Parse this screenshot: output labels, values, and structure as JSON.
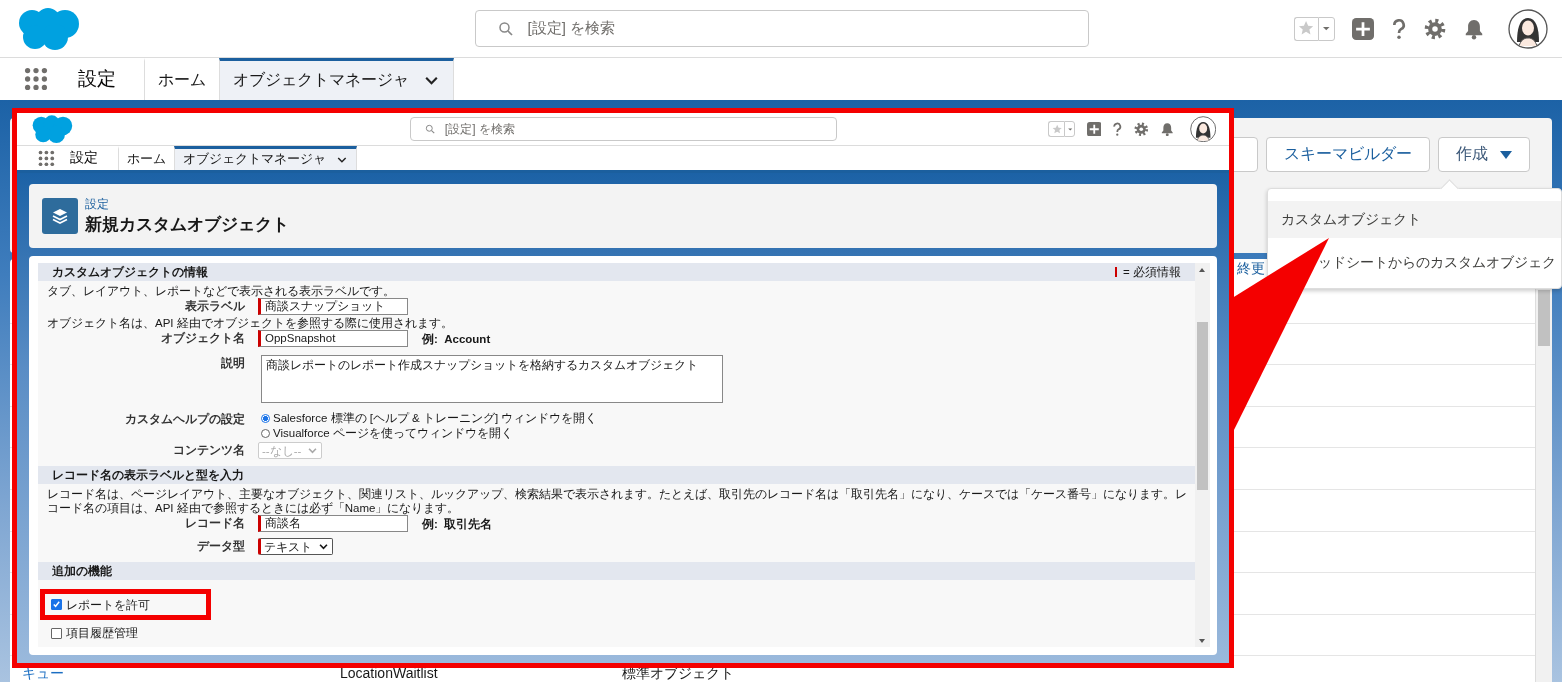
{
  "header": {
    "search": {
      "placeholder": "[設定] を検索"
    }
  },
  "nav": {
    "app_name": "設定",
    "tabs": [
      {
        "label": "ホーム",
        "selected": false
      },
      {
        "label": "オブジェクトマネージャ",
        "selected": true
      }
    ]
  },
  "toolbar": {
    "buttons": [
      {
        "label": "スキーマビルダー",
        "kind": "plain"
      },
      {
        "label": "作成",
        "kind": "menu"
      }
    ]
  },
  "create_menu": {
    "items": [
      {
        "label": "カスタムオブジェクト",
        "selected": true
      },
      {
        "label": "ッドシートからのカスタムオブジェク",
        "selected": false
      }
    ]
  },
  "table": {
    "column_4_header": "終更",
    "rows": [
      {
        "cells": [
          {
            "text": "キュー",
            "kind": "link"
          },
          {
            "text": "LocationWaitlist",
            "kind": "plain"
          },
          {
            "text": "標準オブジェクト",
            "kind": "plain"
          }
        ]
      }
    ]
  },
  "screenshot": {
    "header": {
      "search": {
        "placeholder": "[設定] を検索"
      }
    },
    "nav": {
      "app_name": "設定",
      "tabs": [
        {
          "label": "ホーム",
          "selected": false
        },
        {
          "label": "オブジェクトマネージャ",
          "selected": true
        }
      ]
    },
    "page": {
      "breadcrumb": "設定",
      "title": "新規カスタムオブジェクト"
    },
    "form": {
      "required_legend": "= 必須情報",
      "sections": [
        {
          "title": "カスタムオブジェクトの情報",
          "fields": [
            {
              "kind": "hint",
              "text": "タブ、レイアウト、レポートなどで表示される表示ラベルです。"
            },
            {
              "kind": "text",
              "label": "表示ラベル",
              "value": "商談スナップショット",
              "required": true
            },
            {
              "kind": "hint",
              "text": "オブジェクト名は、API 経由でオブジェクトを参照する際に使用されます。"
            },
            {
              "kind": "text",
              "label": "オブジェクト名",
              "value": "OppSnapshot",
              "required": true,
              "example": "例:  Account"
            },
            {
              "kind": "textarea",
              "label": "説明",
              "value": "商談レポートのレポート作成スナップショットを格納するカスタムオブジェクト"
            },
            {
              "kind": "radio",
              "label": "カスタムヘルプの設定",
              "options": [
                {
                  "label": "Salesforce 標準の [ヘルプ & トレーニング] ウィンドウを開く",
                  "selected": true
                },
                {
                  "label": "Visualforce ページを使ってウィンドウを開く",
                  "selected": false
                }
              ]
            },
            {
              "kind": "select",
              "label": "コンテンツ名",
              "value": "--なし--",
              "disabled": true,
              "required": false
            }
          ]
        },
        {
          "title": "レコード名の表示ラベルと型を入力",
          "fields": [
            {
              "kind": "hint",
              "text": "レコード名は、ページレイアウト、主要なオブジェクト、関連リスト、ルックアップ、検索結果で表示されます。たとえば、取引先のレコード名は「取引先名」になり、ケースでは「ケース番号」になります。レコード名の項目は、API 経由で参照するときには必ず「Name」になります。"
            },
            {
              "kind": "text",
              "label": "レコード名",
              "value": "商談名",
              "required": true,
              "example": "例:  取引先名"
            },
            {
              "kind": "select",
              "label": "データ型",
              "value": "テキスト",
              "disabled": false,
              "required": true
            }
          ]
        },
        {
          "title": "追加の機能",
          "fields": [
            {
              "kind": "checkbox",
              "label": "レポートを許可",
              "checked": true,
              "highlighted": true
            },
            {
              "kind": "checkbox",
              "label": "項目履歴管理",
              "checked": false,
              "highlighted": false
            }
          ]
        }
      ]
    }
  }
}
